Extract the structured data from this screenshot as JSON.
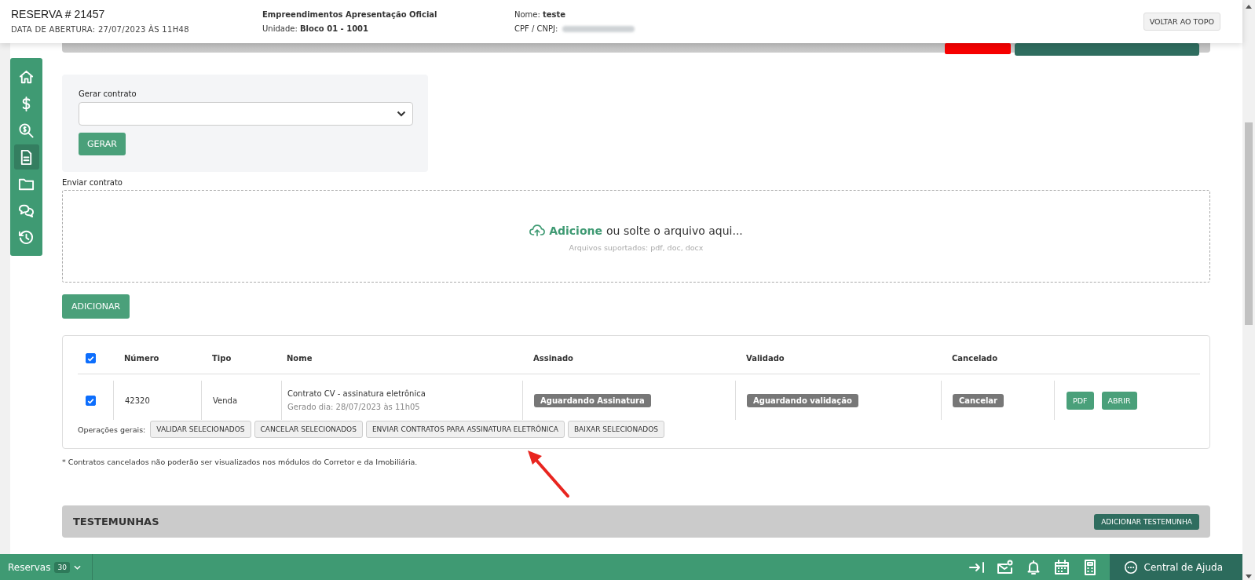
{
  "header": {
    "title": "RESERVA # 21457",
    "opening_date": "DATA DE ABERTURA: 27/07/2023 ÀS 11H48",
    "development": "Empreendimentos Apresentação Oficial",
    "unit": "Unidade: **Bloco 01 - 1001**",
    "name": "Nome: **teste**",
    "cpf_label": "CPF / CNPJ:",
    "top_button": "VOLTAR AO TOPO"
  },
  "sidebar": {
    "items": [
      {
        "selected": false
      },
      {
        "selected": false
      },
      {
        "selected": false
      },
      {
        "selected": true
      },
      {
        "selected": false
      },
      {
        "selected": false
      },
      {
        "selected": false
      }
    ]
  },
  "generate": {
    "label": "Gerar contrato",
    "button": "GERAR"
  },
  "upload": {
    "label": "Enviar contrato",
    "link": "Adicione",
    "text": "ou solte o arquivo aqui...",
    "hint": "Arquivos suportados: pdf, doc, docx"
  },
  "add_button": "ADICIONAR",
  "table": {
    "select_all": {
      "checked": true
    },
    "columns": [
      "Número",
      "Tipo",
      "Nome",
      "Assinado",
      "Validado",
      "Cancelado"
    ],
    "rows": [
      {
        "checked": true,
        "number": "42320",
        "type": "Venda",
        "name": "Contrato CV - assinatura eletrônica",
        "generated": "Gerado dia: 28/07/2023 às 11h05",
        "signed": "Aguardando Assinatura",
        "validated": "Aguardando validação",
        "cancel": "Cancelar",
        "actions": [
          "PDF",
          "ABRIR"
        ]
      }
    ],
    "operations_label": "Operações gerais:",
    "operations": [
      "VALIDAR SELECIONADOS",
      "CANCELAR SELECIONADOS",
      "ENVIAR CONTRATOS PARA ASSINATURA ELETRÔNICA",
      "BAIXAR SELECIONADOS"
    ]
  },
  "note": "* Contratos cancelados não poderão ser visualizados nos módulos do Corretor e da Imobiliária.",
  "witnesses": {
    "title": "TESTEMUNHAS",
    "button": "ADICIONAR TESTEMUNHA"
  },
  "bottom_bar": {
    "label": "Reservas",
    "count": "30",
    "help": "Central de Ajuda"
  }
}
